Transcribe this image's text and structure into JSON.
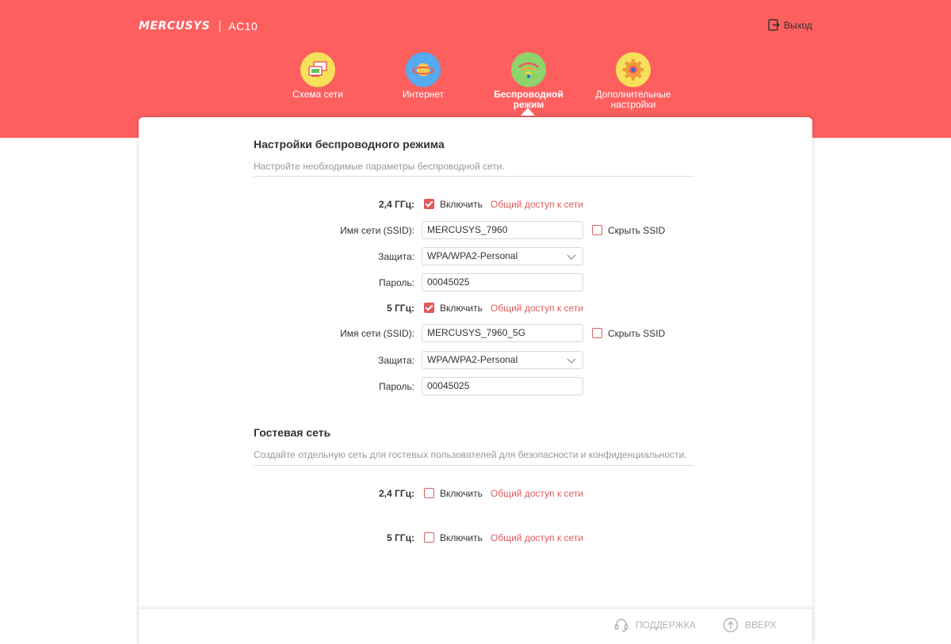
{
  "header": {
    "brand": "MERCUSYS",
    "model": "AC10",
    "logout_label": "Выход",
    "bg_color": "#fd5f5f"
  },
  "nav": {
    "items": [
      {
        "label_line1": "Схема сети",
        "label_line2": "",
        "icon": "network-map-icon",
        "active": false
      },
      {
        "label_line1": "Интернет",
        "label_line2": "",
        "icon": "globe-planet-icon",
        "active": false
      },
      {
        "label_line1": "Беспроводной",
        "label_line2": "режим",
        "icon": "wifi-icon",
        "active": true
      },
      {
        "label_line1": "Дополнительные",
        "label_line2": "настройки",
        "icon": "gear-icon",
        "active": false
      }
    ]
  },
  "wireless": {
    "title": "Настройки беспроводного режима",
    "description": "Настройте необходимые параметры беспроводной сети.",
    "band24": {
      "label": "2,4 ГГц:",
      "enabled": true,
      "enable_label": "Включить",
      "share_link": "Общий доступ к сети",
      "ssid_label": "Имя сети (SSID):",
      "ssid_value": "MERCUSYS_7960",
      "hide_ssid_label": "Скрыть SSID",
      "hide_ssid": false,
      "security_label": "Защита:",
      "security_value": "WPA/WPA2-Personal",
      "password_label": "Пароль:",
      "password_value": "00045025"
    },
    "band5": {
      "label": "5 ГГц:",
      "enabled": true,
      "enable_label": "Включить",
      "share_link": "Общий доступ к сети",
      "ssid_label": "Имя сети (SSID):",
      "ssid_value": "MERCUSYS_7960_5G",
      "hide_ssid_label": "Скрыть SSID",
      "hide_ssid": false,
      "security_label": "Защита:",
      "security_value": "WPA/WPA2-Personal",
      "password_label": "Пароль:",
      "password_value": "00045025"
    }
  },
  "guest": {
    "title": "Гостевая сеть",
    "description": "Создайте отдельную сеть для гостевых пользователей для безопасности и конфиденциальности.",
    "band24": {
      "label": "2,4 ГГц:",
      "enabled": false,
      "enable_label": "Включить",
      "share_link": "Общий доступ к сети"
    },
    "band5": {
      "label": "5 ГГц:",
      "enabled": false,
      "enable_label": "Включить",
      "share_link": "Общий доступ к сети"
    }
  },
  "footer": {
    "support_label": "ПОДДЕРЖКА",
    "top_label": "ВВЕРХ"
  }
}
